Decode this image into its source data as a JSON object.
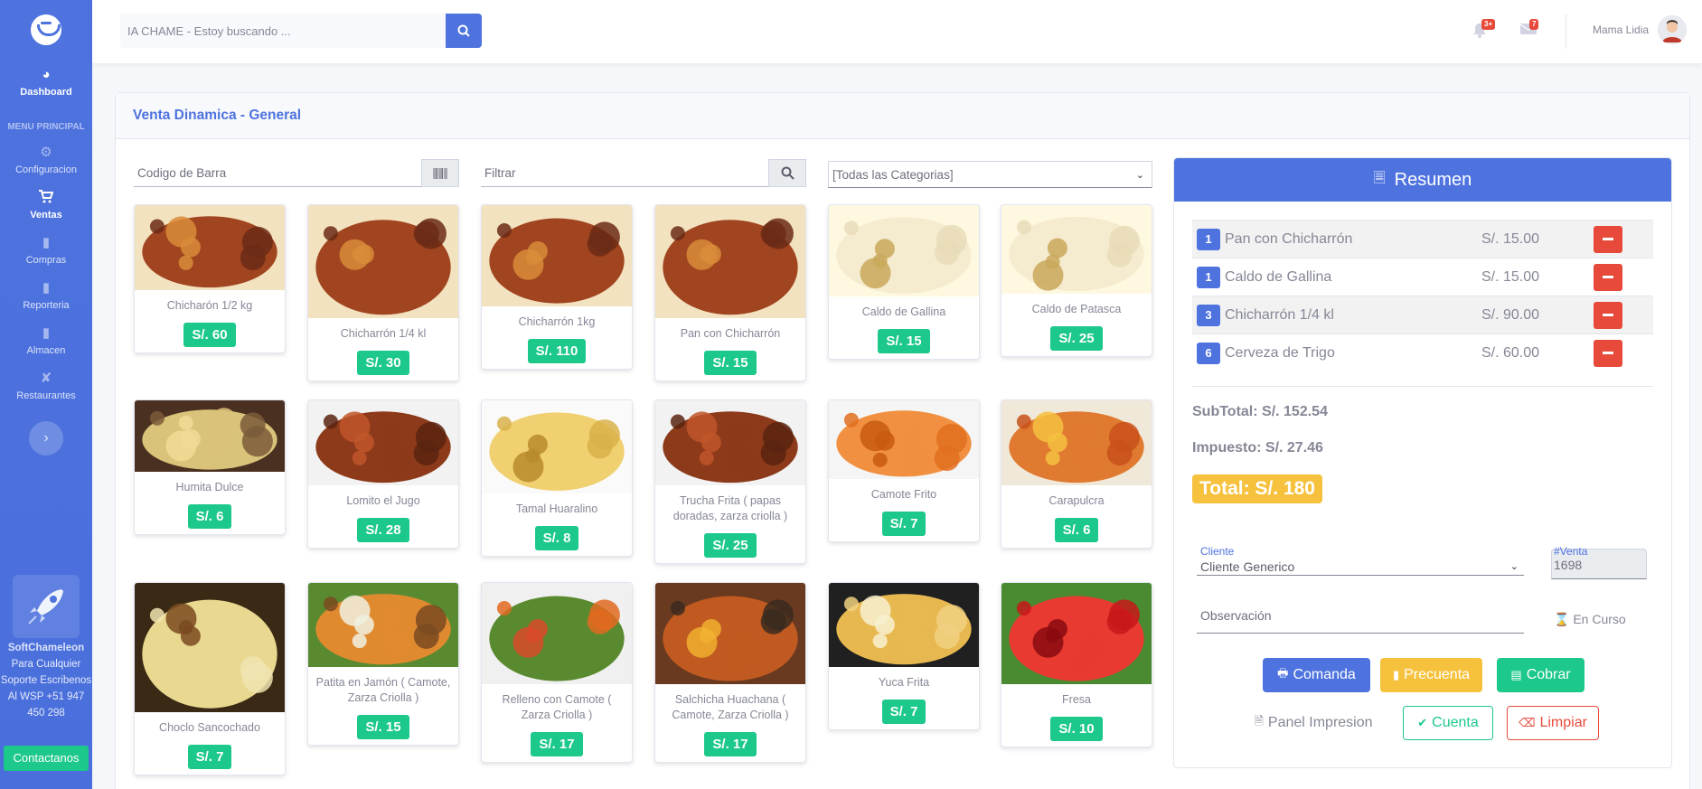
{
  "sidebar": {
    "items": [
      {
        "label": "Dashboard",
        "icon": "tachometer-icon"
      },
      {
        "label": "Configuracion",
        "icon": "gear-icon"
      },
      {
        "label": "Ventas",
        "icon": "cart-icon"
      },
      {
        "label": "Compras",
        "icon": "document-icon"
      },
      {
        "label": "Reporteria",
        "icon": "document-icon"
      },
      {
        "label": "Almacen",
        "icon": "document-icon"
      },
      {
        "label": "Restaurantes",
        "icon": "utensils-icon"
      }
    ],
    "heading": "MENU PRINCIPAL",
    "promo_title": "SoftChameleon",
    "promo_text": "Para Cualquier Soporte Escribenos Al WSP +51 947 450 298",
    "contact_label": "Contactanos"
  },
  "topbar": {
    "search_placeholder": "IA CHAME - Estoy buscando ...",
    "alerts_badge": "3+",
    "messages_badge": "7",
    "username": "Mama Lidia"
  },
  "card": {
    "title": "Venta Dinamica - General",
    "barcode_placeholder": "Codigo de Barra",
    "filter_placeholder": "Filtrar",
    "category_selected": "[Todas las Categorias]"
  },
  "products": [
    {
      "name": "Chicharón 1/2 kg",
      "price": "S/. 60",
      "img": "meat"
    },
    {
      "name": "Chicharrón 1/4 kl",
      "price": "S/. 30",
      "img": "meat"
    },
    {
      "name": "Chicharrón 1kg",
      "price": "S/. 110",
      "img": "meat"
    },
    {
      "name": "Pan con Chicharrón",
      "price": "S/. 15",
      "img": "meat"
    },
    {
      "name": "Caldo de Gallina",
      "price": "S/. 15",
      "img": "soup"
    },
    {
      "name": "Caldo de Patasca",
      "price": "S/. 25",
      "img": "soup"
    },
    {
      "name": "Humita Dulce",
      "price": "S/. 6",
      "img": "humita"
    },
    {
      "name": "Lomito el Jugo",
      "price": "S/. 28",
      "img": "lomo"
    },
    {
      "name": "Tamal Huaralino",
      "price": "S/. 8",
      "img": "tamal"
    },
    {
      "name": "Trucha Frita ( papas doradas, zarza criolla )",
      "price": "S/. 25",
      "img": "lomo"
    },
    {
      "name": "Camote Frito",
      "price": "S/. 7",
      "img": "camote"
    },
    {
      "name": "Carapulcra",
      "price": "S/. 6",
      "img": "carapulcra"
    },
    {
      "name": "Choclo Sancochado",
      "price": "S/. 7",
      "img": "choclo"
    },
    {
      "name": "Patita en Jamón ( Camote, Zarza Criolla )",
      "price": "S/. 15",
      "img": "patita"
    },
    {
      "name": "Relleno con Camote ( Zarza Criolla )",
      "price": "S/. 17",
      "img": "relleno"
    },
    {
      "name": "Salchicha Huachana ( Camote, Zarza Criolla )",
      "price": "S/. 17",
      "img": "salchicha"
    },
    {
      "name": "Yuca Frita",
      "price": "S/. 7",
      "img": "yuca"
    },
    {
      "name": "Fresa",
      "price": "S/. 10",
      "img": "fresa"
    }
  ],
  "resumen": {
    "title": "Resumen",
    "items": [
      {
        "qty": "1",
        "name": "Pan con Chicharrón",
        "price": "S/. 15.00"
      },
      {
        "qty": "1",
        "name": "Caldo de Gallina",
        "price": "S/. 15.00"
      },
      {
        "qty": "3",
        "name": "Chicharrón 1/4 kl",
        "price": "S/. 90.00"
      },
      {
        "qty": "6",
        "name": "Cerveza de Trigo",
        "price": "S/. 60.00"
      }
    ],
    "subtotal": "SubTotal: S/. 152.54",
    "impuesto": "Impuesto: S/. 27.46",
    "total": "Total: S/. 180",
    "cliente_label": "Cliente",
    "cliente_value": "Cliente Generico",
    "venta_label": "#Venta",
    "venta_value": "1698",
    "observacion_placeholder": "Observación",
    "status": "En Curso",
    "buttons": {
      "comanda": "Comanda",
      "precuenta": "Precuenta",
      "cobrar": "Cobrar",
      "panel": "Panel Impresion",
      "cuenta": "Cuenta",
      "limpiar": "Limpiar"
    }
  },
  "colors": {
    "primary": "#4e73df",
    "success": "#1cc88a",
    "warning": "#f6c23e",
    "danger": "#e74a3b"
  }
}
